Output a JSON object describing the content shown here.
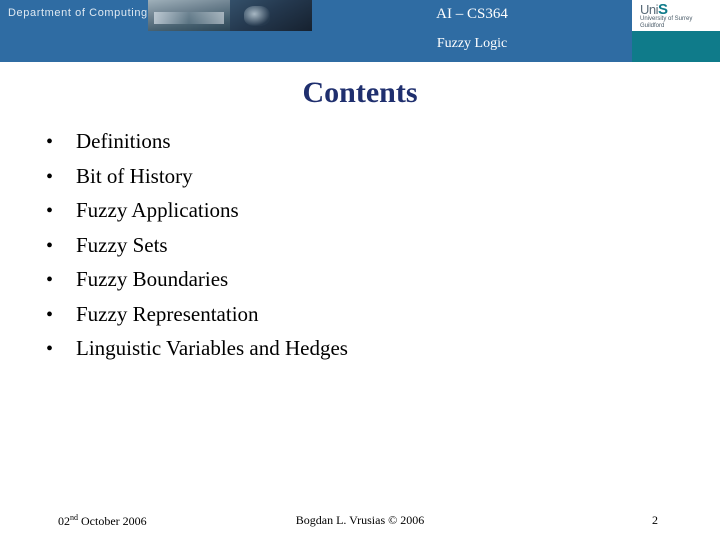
{
  "header": {
    "department_label": "Department of Computing",
    "title": "AI – CS364",
    "subtitle": "Fuzzy Logic",
    "logo": {
      "name_prefix": "Uni",
      "name_suffix": "S",
      "sub_line1": "University of Surrey",
      "sub_line2": "Guildford"
    },
    "colors": {
      "band_blue": "#2f6ca3",
      "teal": "#0f7b8a"
    }
  },
  "slide": {
    "title": "Contents",
    "title_color": "#1f2f6e",
    "bullet_glyph": "•",
    "bullets": [
      {
        "label": "Definitions"
      },
      {
        "label": "Bit of History"
      },
      {
        "label": "Fuzzy Applications"
      },
      {
        "label": "Fuzzy Sets"
      },
      {
        "label": "Fuzzy Boundaries"
      },
      {
        "label": "Fuzzy Representation"
      },
      {
        "label": "Linguistic Variables and Hedges"
      }
    ]
  },
  "footer": {
    "date_number": "02",
    "date_ordinal": "nd",
    "date_rest": " October 2006",
    "author": "Bogdan L. Vrusias © 2006",
    "page_number": "2"
  }
}
